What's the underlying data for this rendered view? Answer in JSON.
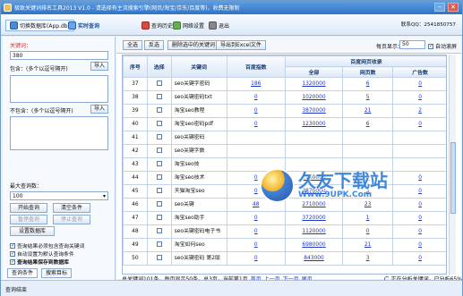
{
  "title": "极致关键词排名工具2013 V1.0 - 请选择有主流搜索引擎(网页/淘宝/京东/百度等)，收费无限制",
  "window": {
    "minimize": "–",
    "close": "×"
  },
  "toolbar": {
    "db_button": "切换数据库(App.db)",
    "realtime": "实时查询",
    "history": "查询历史",
    "network": "网络设置",
    "exit": "退出",
    "contact": "联系QQ：2541850757"
  },
  "left": {
    "keyword_label": "关键词：",
    "keyword_value": "380",
    "include_label": "包含：(多个以逗号隔开)",
    "exclude_label": "不包含：(多个以逗号隔开)",
    "import": "导入",
    "max_label": "最大查询数：",
    "max_value": "100",
    "start": "开始查询",
    "clear": "清空条件",
    "pause": "暂停查询",
    "stop": "停止查询",
    "save": "设置数据库",
    "opt1": "查询结果必须包含查询关键词",
    "opt2": "自动设置为默认查询条件",
    "opt3": "查询结果保存到数据库",
    "tab1": "查询条件",
    "tab2": "搜索目标"
  },
  "actions": {
    "select_all": "全选",
    "invert": "反选",
    "delete_selected": "删除选中的关键词",
    "export_excel": "导出到Excel文件",
    "page_size_label": "每页显示：",
    "page_size": "50",
    "auto_scroll": "自动滚屏"
  },
  "table": {
    "headers": {
      "seq": "序号",
      "select": "选择",
      "keyword": "关键词",
      "index": "百度指数",
      "records": "百度网页收录",
      "all": "全部",
      "pages": "网页数",
      "ads": "广告数"
    },
    "rows": [
      {
        "seq": "37",
        "kw": "seo关键字密码",
        "idx": "186",
        "all": "1320000",
        "pg": "6",
        "ad": "0"
      },
      {
        "seq": "38",
        "kw": "seo关键密码txt",
        "idx": "0",
        "all": "1020000",
        "pg": "5",
        "ad": "0"
      },
      {
        "seq": "39",
        "kw": "淘宝seo教程",
        "idx": "0",
        "all": "3870000",
        "pg": "21",
        "ad": "2"
      },
      {
        "seq": "40",
        "kw": "淘宝seo密码pdf",
        "idx": "0",
        "all": "1230000",
        "pg": "6",
        "ad": "0"
      },
      {
        "seq": "41",
        "kw": "seo关键密码",
        "idx": "",
        "all": "",
        "pg": "",
        "ad": ""
      },
      {
        "seq": "42",
        "kw": "seo关键字数",
        "idx": "",
        "all": "",
        "pg": "",
        "ad": ""
      },
      {
        "seq": "43",
        "kw": "淘宝seo技",
        "idx": "",
        "all": "",
        "pg": "",
        "ad": ""
      },
      {
        "seq": "44",
        "kw": "淘宝seo技术",
        "idx": "0",
        "all": "1160000",
        "pg": "3",
        "ad": "0"
      },
      {
        "seq": "45",
        "kw": "天猫淘宝seo",
        "idx": "0",
        "all": "3870000",
        "pg": "3",
        "ad": "0"
      },
      {
        "seq": "46",
        "kw": "seo关键",
        "idx": "48",
        "all": "2710000",
        "pg": "23",
        "ad": "0"
      },
      {
        "seq": "47",
        "kw": "淘宝seo助手",
        "idx": "0",
        "all": "3720000",
        "pg": "1",
        "ad": "0"
      },
      {
        "seq": "48",
        "kw": "seo关键密码电子书",
        "idx": "0",
        "all": "1120000",
        "pg": "0",
        "ad": "0"
      },
      {
        "seq": "49",
        "kw": "淘宝如何seo",
        "idx": "0",
        "all": "6980000",
        "pg": "21",
        "ad": "0"
      },
      {
        "seq": "50",
        "kw": "seo关键密码 第2版",
        "idx": "0",
        "all": "843000",
        "pg": "3",
        "ad": "0"
      }
    ]
  },
  "watermark": {
    "title": "久友下载站",
    "url": "Www.9UPK.Com"
  },
  "footer": {
    "summary": "总关键词101条，每页显示50条，总3页，当前第1页",
    "first": "首页",
    "prev": "上一页",
    "next": "下一页",
    "last": "尾页",
    "progress": "正在分析关键词，已分析65%"
  },
  "status": {
    "text": "查询结束"
  }
}
